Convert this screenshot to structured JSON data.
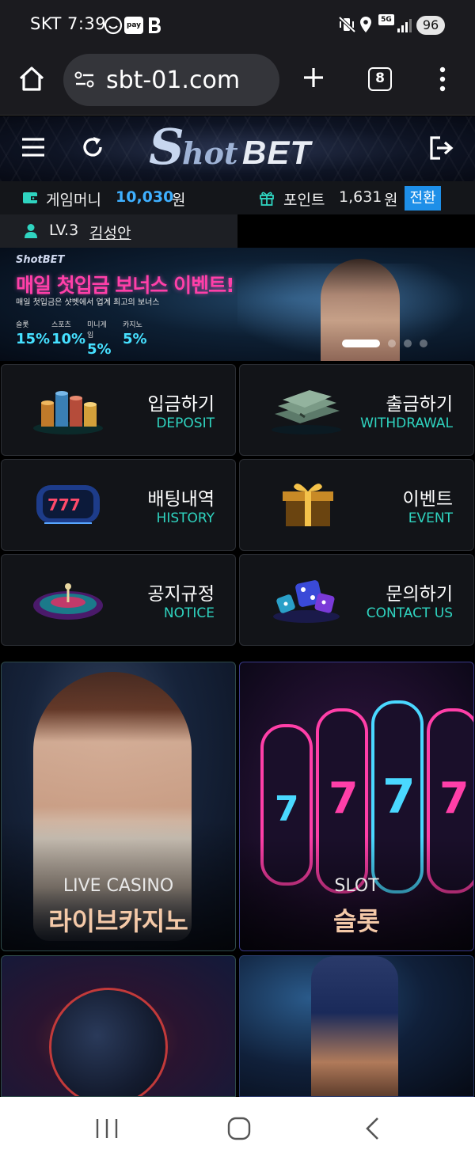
{
  "status_bar": {
    "carrier_time": "SKT 7:39",
    "pay_badge": "pay",
    "network": "5G",
    "battery": "96"
  },
  "browser": {
    "url": "sbt-01.com",
    "tab_count": "8"
  },
  "logo": {
    "s": "S",
    "hot": "hot",
    "bet": "BET"
  },
  "account": {
    "money_label": "게임머니",
    "money_value": "10,030",
    "money_unit": "원",
    "point_label": "포인트",
    "point_value": "1,631",
    "point_unit": "원",
    "convert_label": "전환",
    "level": "LV.3",
    "username": "김성안"
  },
  "banner": {
    "brand": "ShotBET",
    "title": "매일 첫입금 보너스 이벤트!",
    "subtitle": "매일 첫입금은 샷벳에서 업계 최고의 보너스",
    "rates": [
      {
        "label": "슬롯",
        "value": "15%"
      },
      {
        "label": "스포츠",
        "value": "10%"
      },
      {
        "label": "미니게임",
        "value": "5%"
      },
      {
        "label": "카지노",
        "value": "5%"
      }
    ]
  },
  "menu": [
    {
      "ko": "입금하기",
      "en": "DEPOSIT"
    },
    {
      "ko": "출금하기",
      "en": "WITHDRAWAL"
    },
    {
      "ko": "배팅내역",
      "en": "HISTORY"
    },
    {
      "ko": "이벤트",
      "en": "EVENT"
    },
    {
      "ko": "공지규정",
      "en": "NOTICE"
    },
    {
      "ko": "문의하기",
      "en": "CONTACT US"
    }
  ],
  "games": [
    {
      "en": "LIVE CASINO",
      "ko": "라이브카지노"
    },
    {
      "en": "SLOT",
      "ko": "슬롯"
    }
  ]
}
